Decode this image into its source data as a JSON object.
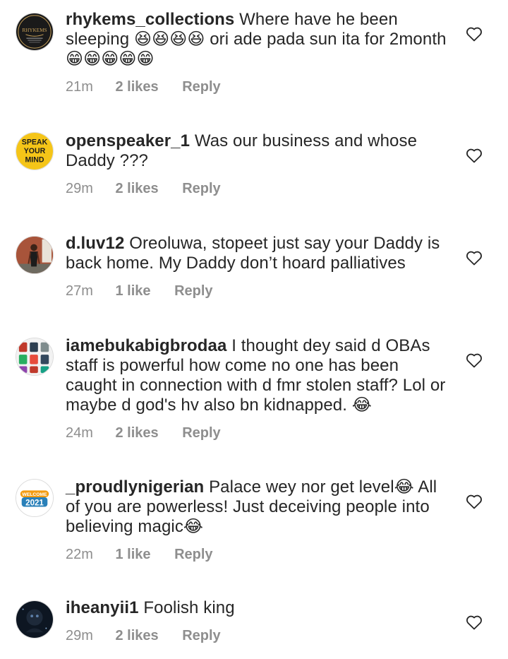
{
  "comments": [
    {
      "username": "rhykems_collections",
      "text": "Where have he been sleeping 😆😆😆😆 ori ade pada sun ita for 2month 😁😁😁😁😁",
      "time": "21m",
      "likes": "2 likes",
      "reply": "Reply",
      "avatar_icon": "rhykems-logo-avatar",
      "avatar_text": "RHYKEMS"
    },
    {
      "username": "openspeaker_1",
      "text": "Was our business and whose Daddy ???",
      "time": "29m",
      "likes": "2 likes",
      "reply": "Reply",
      "avatar_icon": "speak-your-mind-avatar",
      "avatar_text": "SPEAK YOUR MIND"
    },
    {
      "username": "d.luv12",
      "text": "Oreoluwa, stopeet just say your Daddy is back home. My Daddy don’t hoard palliatives",
      "time": "27m",
      "likes": "1 like",
      "reply": "Reply",
      "avatar_icon": "person-photo-avatar"
    },
    {
      "username": "iamebukabigbrodaa",
      "text": "I thought dey said d OBAs staff is powerful how come no one has been caught in connection with d fmr stolen staff? Lol or maybe d god's hv also bn kidnapped. 😂",
      "time": "24m",
      "likes": "2 likes",
      "reply": "Reply",
      "avatar_icon": "clothing-grid-avatar"
    },
    {
      "username": "_proudlynigerian",
      "text": "Palace wey nor get level😂 All of you are powerless!  Just deceiving people into believing magic😂",
      "time": "22m",
      "likes": "1 like",
      "reply": "Reply",
      "avatar_icon": "welcome-2021-avatar",
      "avatar_text": "WELCOME 2021"
    },
    {
      "username": "iheanyii1",
      "text": "Foolish king",
      "time": "29m",
      "likes": "2 likes",
      "reply": "Reply",
      "avatar_icon": "dark-photo-avatar"
    }
  ],
  "icons": {
    "like": "heart-outline-icon"
  },
  "colors": {
    "text": "#262626",
    "meta": "#8e8e8e"
  }
}
